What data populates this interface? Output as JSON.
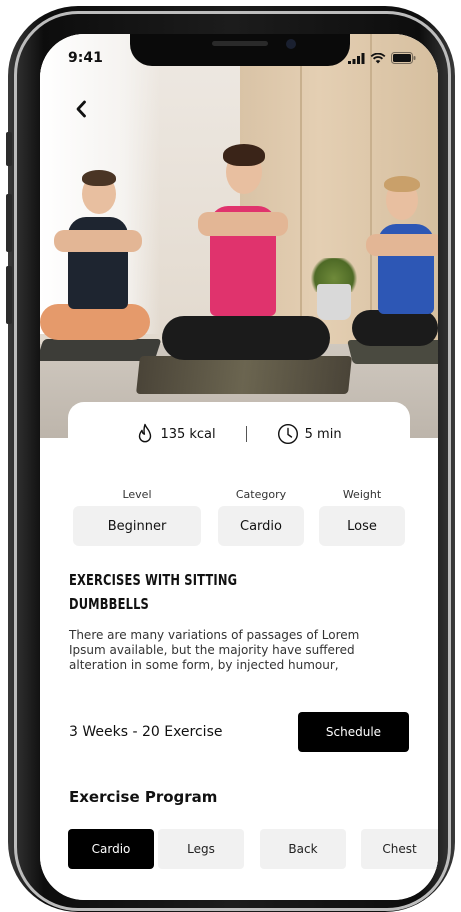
{
  "status_bar": {
    "time": "9:41"
  },
  "nav": {
    "back_icon": "chevron-left-icon"
  },
  "stats": {
    "calories": "135 kcal",
    "calories_icon": "flame-icon",
    "duration": "5 min",
    "duration_icon": "clock-icon"
  },
  "info": [
    {
      "label": "Level",
      "value": "Beginner"
    },
    {
      "label": "Category",
      "value": "Cardio"
    },
    {
      "label": "Weight",
      "value": "Lose"
    }
  ],
  "exercise": {
    "title": "Exercises with sitting dumbbells",
    "description": "There are many variations of passages of Lorem Ipsum available, but the majority have suffered alteration in some form, by injected humour,"
  },
  "plan": {
    "summary": "3 Weeks - 20 Exercise",
    "schedule_label": "Schedule"
  },
  "program": {
    "title": "Exercise Program",
    "tabs": [
      {
        "label": "Cardio",
        "active": true
      },
      {
        "label": "Legs",
        "active": false
      },
      {
        "label": "Back",
        "active": false
      },
      {
        "label": "Chest",
        "active": false
      }
    ]
  },
  "colors": {
    "primary": "#000000",
    "chip_bg": "#f1f1f1",
    "text": "#111111"
  }
}
